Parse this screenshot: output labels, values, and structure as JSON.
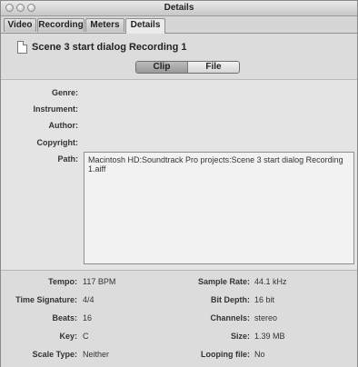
{
  "window": {
    "title": "Details"
  },
  "tabs": [
    {
      "label": "Video"
    },
    {
      "label": "Recording"
    },
    {
      "label": "Meters"
    },
    {
      "label": "Details"
    }
  ],
  "header": {
    "title": "Scene 3 start dialog Recording 1",
    "segments": [
      {
        "label": "Clip",
        "selected": true
      },
      {
        "label": "File",
        "selected": false
      }
    ]
  },
  "metadata": {
    "genre_label": "Genre:",
    "instrument_label": "Instrument:",
    "author_label": "Author:",
    "copyright_label": "Copyright:",
    "path_label": "Path:",
    "path_value": "Macintosh HD:Soundtrack Pro projects:Scene 3 start dialog Recording 1.aiff"
  },
  "info": {
    "tempo": {
      "label": "Tempo:",
      "value": "117 BPM"
    },
    "time_signature": {
      "label": "Time Signature:",
      "value": "4/4"
    },
    "beats": {
      "label": "Beats:",
      "value": "16"
    },
    "key": {
      "label": "Key:",
      "value": "C"
    },
    "scale_type": {
      "label": "Scale Type:",
      "value": "Neither"
    },
    "sample_rate": {
      "label": "Sample Rate:",
      "value": "44.1 kHz"
    },
    "bit_depth": {
      "label": "Bit Depth:",
      "value": "16 bit"
    },
    "channels": {
      "label": "Channels:",
      "value": "stereo"
    },
    "size": {
      "label": "Size:",
      "value": "1.39 MB"
    },
    "looping_file": {
      "label": "Looping file:",
      "value": "No"
    }
  }
}
